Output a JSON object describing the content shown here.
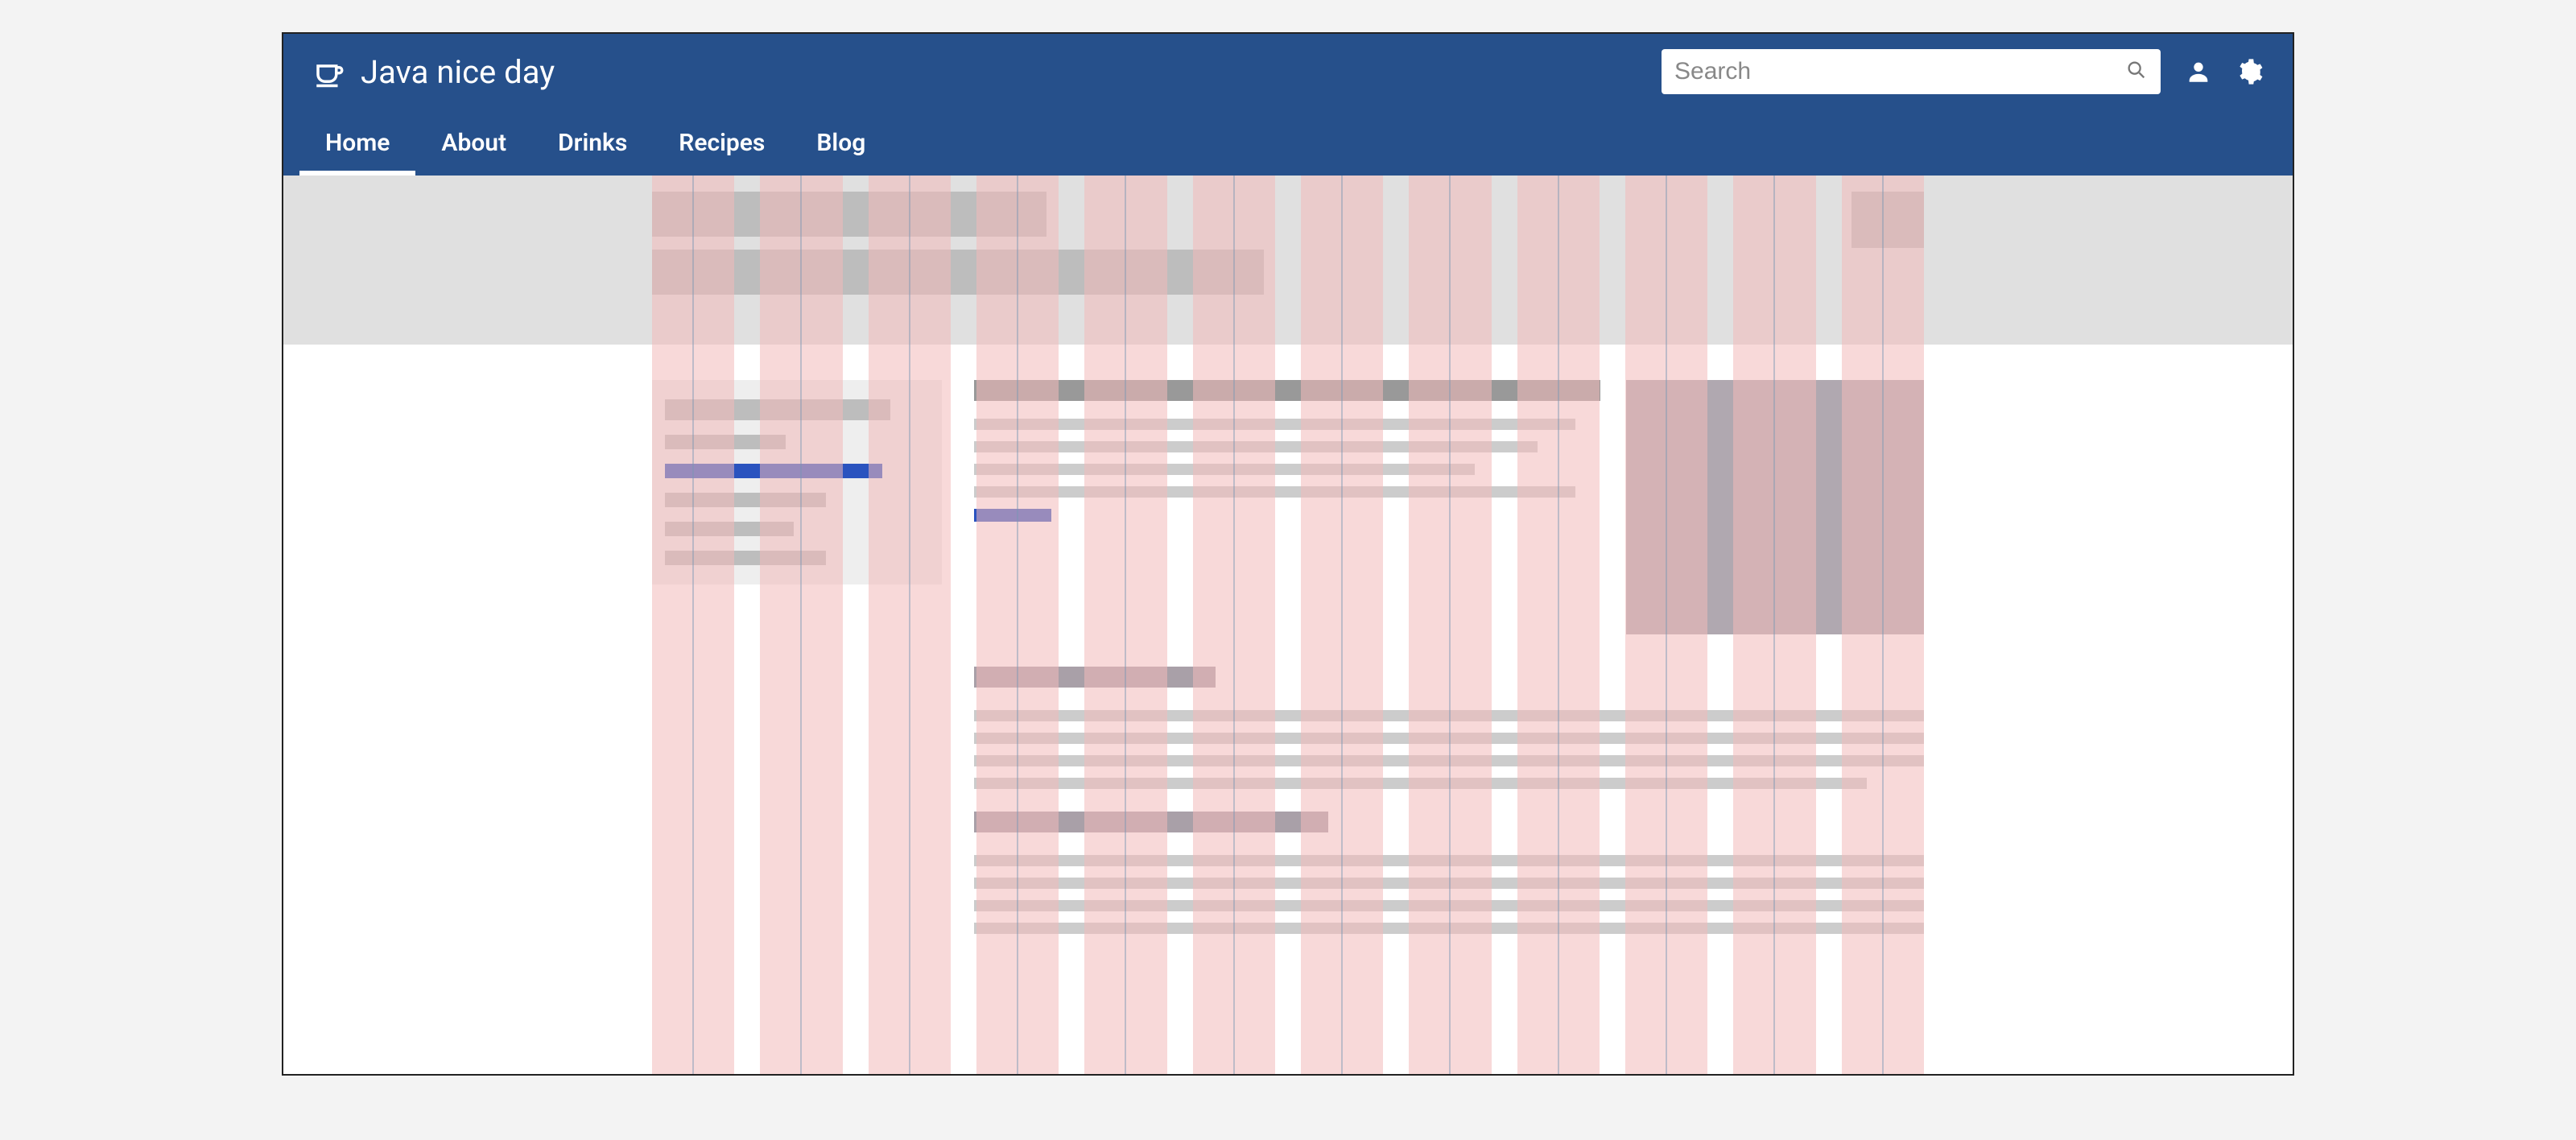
{
  "brand": {
    "title": "Java nice day"
  },
  "search": {
    "placeholder": "Search"
  },
  "nav": {
    "items": [
      {
        "label": "Home",
        "active": true
      },
      {
        "label": "About",
        "active": false
      },
      {
        "label": "Drinks",
        "active": false
      },
      {
        "label": "Recipes",
        "active": false
      },
      {
        "label": "Blog",
        "active": false
      }
    ]
  },
  "icons": {
    "logo": "cup-icon",
    "search": "search-icon",
    "user": "user-icon",
    "settings": "gear-icon"
  },
  "layout": {
    "grid_columns": 12
  }
}
